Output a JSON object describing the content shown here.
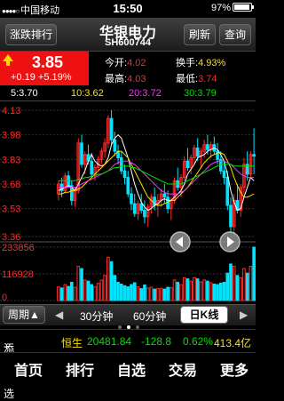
{
  "status_bar": {
    "carrier": "中国移动",
    "time": "15:50",
    "battery": "97%",
    "battery_level": 0.97
  },
  "nav": {
    "left_button": "涨跌排行",
    "title": "华银电力",
    "subtitle": "SH600744",
    "refresh": "刷新",
    "query": "查询"
  },
  "quote": {
    "price": "3.85",
    "change": "+0.19",
    "change_pct": "+5.19%",
    "open_label": "今开:",
    "open": "4.02",
    "turnover_label": "换手:",
    "turnover": "4.93%",
    "high_label": "最高:",
    "high": "4.03",
    "low_label": "最低:",
    "low": "3.74"
  },
  "ma": {
    "ma5": "5:3.70",
    "ma10": "10:3.62",
    "ma20": "20:3.72",
    "ma30": "30:3.79"
  },
  "colors": {
    "up": "#ff2a2a",
    "down": "#00e5ff",
    "ma5": "#ffffff",
    "ma10": "#ffe000",
    "ma20": "#ff33ff",
    "ma30": "#00e000"
  },
  "chart_data": {
    "type": "candlestick",
    "price_ticks": [
      "4.13",
      "3.98",
      "3.83",
      "3.68",
      "3.53",
      "3.36"
    ],
    "price_range": [
      3.36,
      4.13
    ],
    "volume_ticks": [
      "233856",
      "116928",
      "0"
    ],
    "volume_max": 233856,
    "candles": [
      [
        3.62,
        3.7,
        3.58,
        3.68,
        60000
      ],
      [
        3.68,
        3.72,
        3.6,
        3.64,
        55000
      ],
      [
        3.64,
        3.75,
        3.62,
        3.73,
        70000
      ],
      [
        3.73,
        3.76,
        3.66,
        3.67,
        62000
      ],
      [
        3.67,
        3.7,
        3.55,
        3.58,
        80000
      ],
      [
        3.58,
        3.66,
        3.54,
        3.64,
        58000
      ],
      [
        3.64,
        3.96,
        3.62,
        3.93,
        150000
      ],
      [
        3.93,
        3.98,
        3.78,
        3.8,
        140000
      ],
      [
        3.8,
        3.88,
        3.74,
        3.86,
        90000
      ],
      [
        3.86,
        3.92,
        3.8,
        3.82,
        85000
      ],
      [
        3.82,
        3.87,
        3.72,
        3.74,
        70000
      ],
      [
        3.74,
        3.8,
        3.7,
        3.78,
        60000
      ],
      [
        3.78,
        3.85,
        3.76,
        3.83,
        75000
      ],
      [
        3.83,
        3.9,
        3.8,
        3.88,
        90000
      ],
      [
        3.88,
        3.96,
        3.84,
        3.93,
        110000
      ],
      [
        3.93,
        4.1,
        3.9,
        4.08,
        190000
      ],
      [
        4.08,
        4.13,
        3.92,
        3.95,
        170000
      ],
      [
        3.95,
        4.0,
        3.85,
        3.88,
        110000
      ],
      [
        3.88,
        3.92,
        3.8,
        3.84,
        80000
      ],
      [
        3.84,
        3.88,
        3.74,
        3.76,
        72000
      ],
      [
        3.76,
        3.8,
        3.68,
        3.72,
        65000
      ],
      [
        3.72,
        3.76,
        3.6,
        3.62,
        60000
      ],
      [
        3.62,
        3.66,
        3.52,
        3.56,
        70000
      ],
      [
        3.56,
        3.62,
        3.48,
        3.5,
        78000
      ],
      [
        3.5,
        3.58,
        3.46,
        3.56,
        60000
      ],
      [
        3.56,
        3.62,
        3.5,
        3.52,
        52000
      ],
      [
        3.52,
        3.58,
        3.44,
        3.48,
        68000
      ],
      [
        3.48,
        3.56,
        3.42,
        3.54,
        55000
      ],
      [
        3.54,
        3.62,
        3.5,
        3.6,
        58000
      ],
      [
        3.6,
        3.66,
        3.52,
        3.55,
        50000
      ],
      [
        3.55,
        3.62,
        3.48,
        3.58,
        52000
      ],
      [
        3.58,
        3.65,
        3.54,
        3.62,
        54000
      ],
      [
        3.62,
        3.68,
        3.56,
        3.6,
        50000
      ],
      [
        3.6,
        3.64,
        3.5,
        3.53,
        58000
      ],
      [
        3.53,
        3.6,
        3.46,
        3.58,
        56000
      ],
      [
        3.58,
        3.72,
        3.56,
        3.7,
        90000
      ],
      [
        3.7,
        3.78,
        3.64,
        3.66,
        80000
      ],
      [
        3.66,
        3.74,
        3.6,
        3.72,
        70000
      ],
      [
        3.72,
        3.85,
        3.7,
        3.82,
        100000
      ],
      [
        3.82,
        3.9,
        3.76,
        3.78,
        95000
      ],
      [
        3.78,
        3.86,
        3.74,
        3.84,
        85000
      ],
      [
        3.84,
        3.92,
        3.8,
        3.9,
        100000
      ],
      [
        3.9,
        3.96,
        3.82,
        3.85,
        95000
      ],
      [
        3.85,
        3.9,
        3.78,
        3.88,
        82000
      ],
      [
        3.88,
        3.95,
        3.84,
        3.92,
        90000
      ],
      [
        3.92,
        3.98,
        3.86,
        3.89,
        85000
      ],
      [
        3.89,
        3.94,
        3.84,
        3.92,
        78000
      ],
      [
        3.92,
        3.97,
        3.86,
        3.88,
        72000
      ],
      [
        3.88,
        3.93,
        3.8,
        3.83,
        70000
      ],
      [
        3.83,
        3.88,
        3.74,
        3.76,
        76000
      ],
      [
        3.76,
        3.82,
        3.68,
        3.72,
        80000
      ],
      [
        3.72,
        3.76,
        3.52,
        3.55,
        120000
      ],
      [
        3.55,
        3.6,
        3.38,
        3.42,
        160000
      ],
      [
        3.42,
        3.62,
        3.36,
        3.58,
        150000
      ],
      [
        3.58,
        3.68,
        3.5,
        3.52,
        110000
      ],
      [
        3.52,
        3.68,
        3.48,
        3.66,
        100000
      ],
      [
        3.66,
        3.84,
        3.62,
        3.8,
        140000
      ],
      [
        3.8,
        3.88,
        3.7,
        3.74,
        120000
      ],
      [
        3.74,
        3.88,
        3.72,
        3.86,
        150000
      ],
      [
        3.86,
        4.02,
        3.74,
        3.85,
        233856
      ]
    ],
    "ma_lines": {
      "ma5": [
        3.64,
        3.65,
        3.66,
        3.67,
        3.66,
        3.64,
        3.68,
        3.72,
        3.76,
        3.82,
        3.86,
        3.82,
        3.8,
        3.79,
        3.8,
        3.84,
        3.92,
        3.96,
        3.98,
        3.96,
        3.9,
        3.84,
        3.76,
        3.68,
        3.62,
        3.57,
        3.54,
        3.52,
        3.53,
        3.55,
        3.56,
        3.58,
        3.59,
        3.58,
        3.58,
        3.6,
        3.62,
        3.64,
        3.68,
        3.74,
        3.77,
        3.8,
        3.84,
        3.85,
        3.86,
        3.88,
        3.89,
        3.9,
        3.89,
        3.86,
        3.82,
        3.74,
        3.64,
        3.57,
        3.52,
        3.53,
        3.6,
        3.66,
        3.72,
        3.7
      ],
      "ma10": [
        3.62,
        3.62,
        3.63,
        3.63,
        3.64,
        3.64,
        3.65,
        3.66,
        3.68,
        3.7,
        3.72,
        3.74,
        3.76,
        3.78,
        3.8,
        3.82,
        3.84,
        3.86,
        3.88,
        3.88,
        3.86,
        3.84,
        3.8,
        3.76,
        3.72,
        3.68,
        3.64,
        3.6,
        3.58,
        3.56,
        3.55,
        3.55,
        3.56,
        3.57,
        3.58,
        3.58,
        3.6,
        3.62,
        3.64,
        3.66,
        3.69,
        3.72,
        3.75,
        3.78,
        3.81,
        3.83,
        3.85,
        3.86,
        3.87,
        3.87,
        3.86,
        3.82,
        3.78,
        3.72,
        3.67,
        3.63,
        3.6,
        3.6,
        3.61,
        3.62
      ],
      "ma20": [
        3.66,
        3.66,
        3.66,
        3.66,
        3.66,
        3.66,
        3.67,
        3.68,
        3.69,
        3.7,
        3.71,
        3.72,
        3.73,
        3.74,
        3.75,
        3.76,
        3.78,
        3.8,
        3.81,
        3.82,
        3.82,
        3.82,
        3.81,
        3.8,
        3.78,
        3.76,
        3.74,
        3.72,
        3.7,
        3.68,
        3.66,
        3.64,
        3.63,
        3.62,
        3.62,
        3.62,
        3.62,
        3.63,
        3.64,
        3.66,
        3.68,
        3.7,
        3.72,
        3.74,
        3.76,
        3.78,
        3.8,
        3.81,
        3.82,
        3.82,
        3.82,
        3.81,
        3.8,
        3.78,
        3.76,
        3.74,
        3.73,
        3.72,
        3.72,
        3.72
      ],
      "ma30": [
        3.7,
        3.7,
        3.7,
        3.7,
        3.7,
        3.7,
        3.71,
        3.71,
        3.72,
        3.72,
        3.73,
        3.73,
        3.74,
        3.74,
        3.75,
        3.76,
        3.77,
        3.78,
        3.78,
        3.79,
        3.79,
        3.79,
        3.78,
        3.78,
        3.77,
        3.76,
        3.75,
        3.74,
        3.73,
        3.72,
        3.71,
        3.7,
        3.69,
        3.68,
        3.68,
        3.68,
        3.68,
        3.68,
        3.69,
        3.7,
        3.71,
        3.72,
        3.73,
        3.74,
        3.75,
        3.76,
        3.77,
        3.78,
        3.79,
        3.8,
        3.8,
        3.8,
        3.8,
        3.79,
        3.79,
        3.79,
        3.79,
        3.79,
        3.79,
        3.79
      ]
    }
  },
  "periods": {
    "toggle": "周期▲",
    "left_arrow": "◀",
    "p30": "30分钟",
    "p60": "60分钟",
    "daily": "日K线",
    "right_arrow": "▶"
  },
  "index_bar": {
    "add_watch": "添加自选",
    "index_name": "恒生",
    "index_value": "20481.84",
    "index_change": "-128.8",
    "index_pct": "0.62%",
    "turnover": "413.4亿"
  },
  "tabs": [
    "首页",
    "排行",
    "自选",
    "交易",
    "更多"
  ]
}
